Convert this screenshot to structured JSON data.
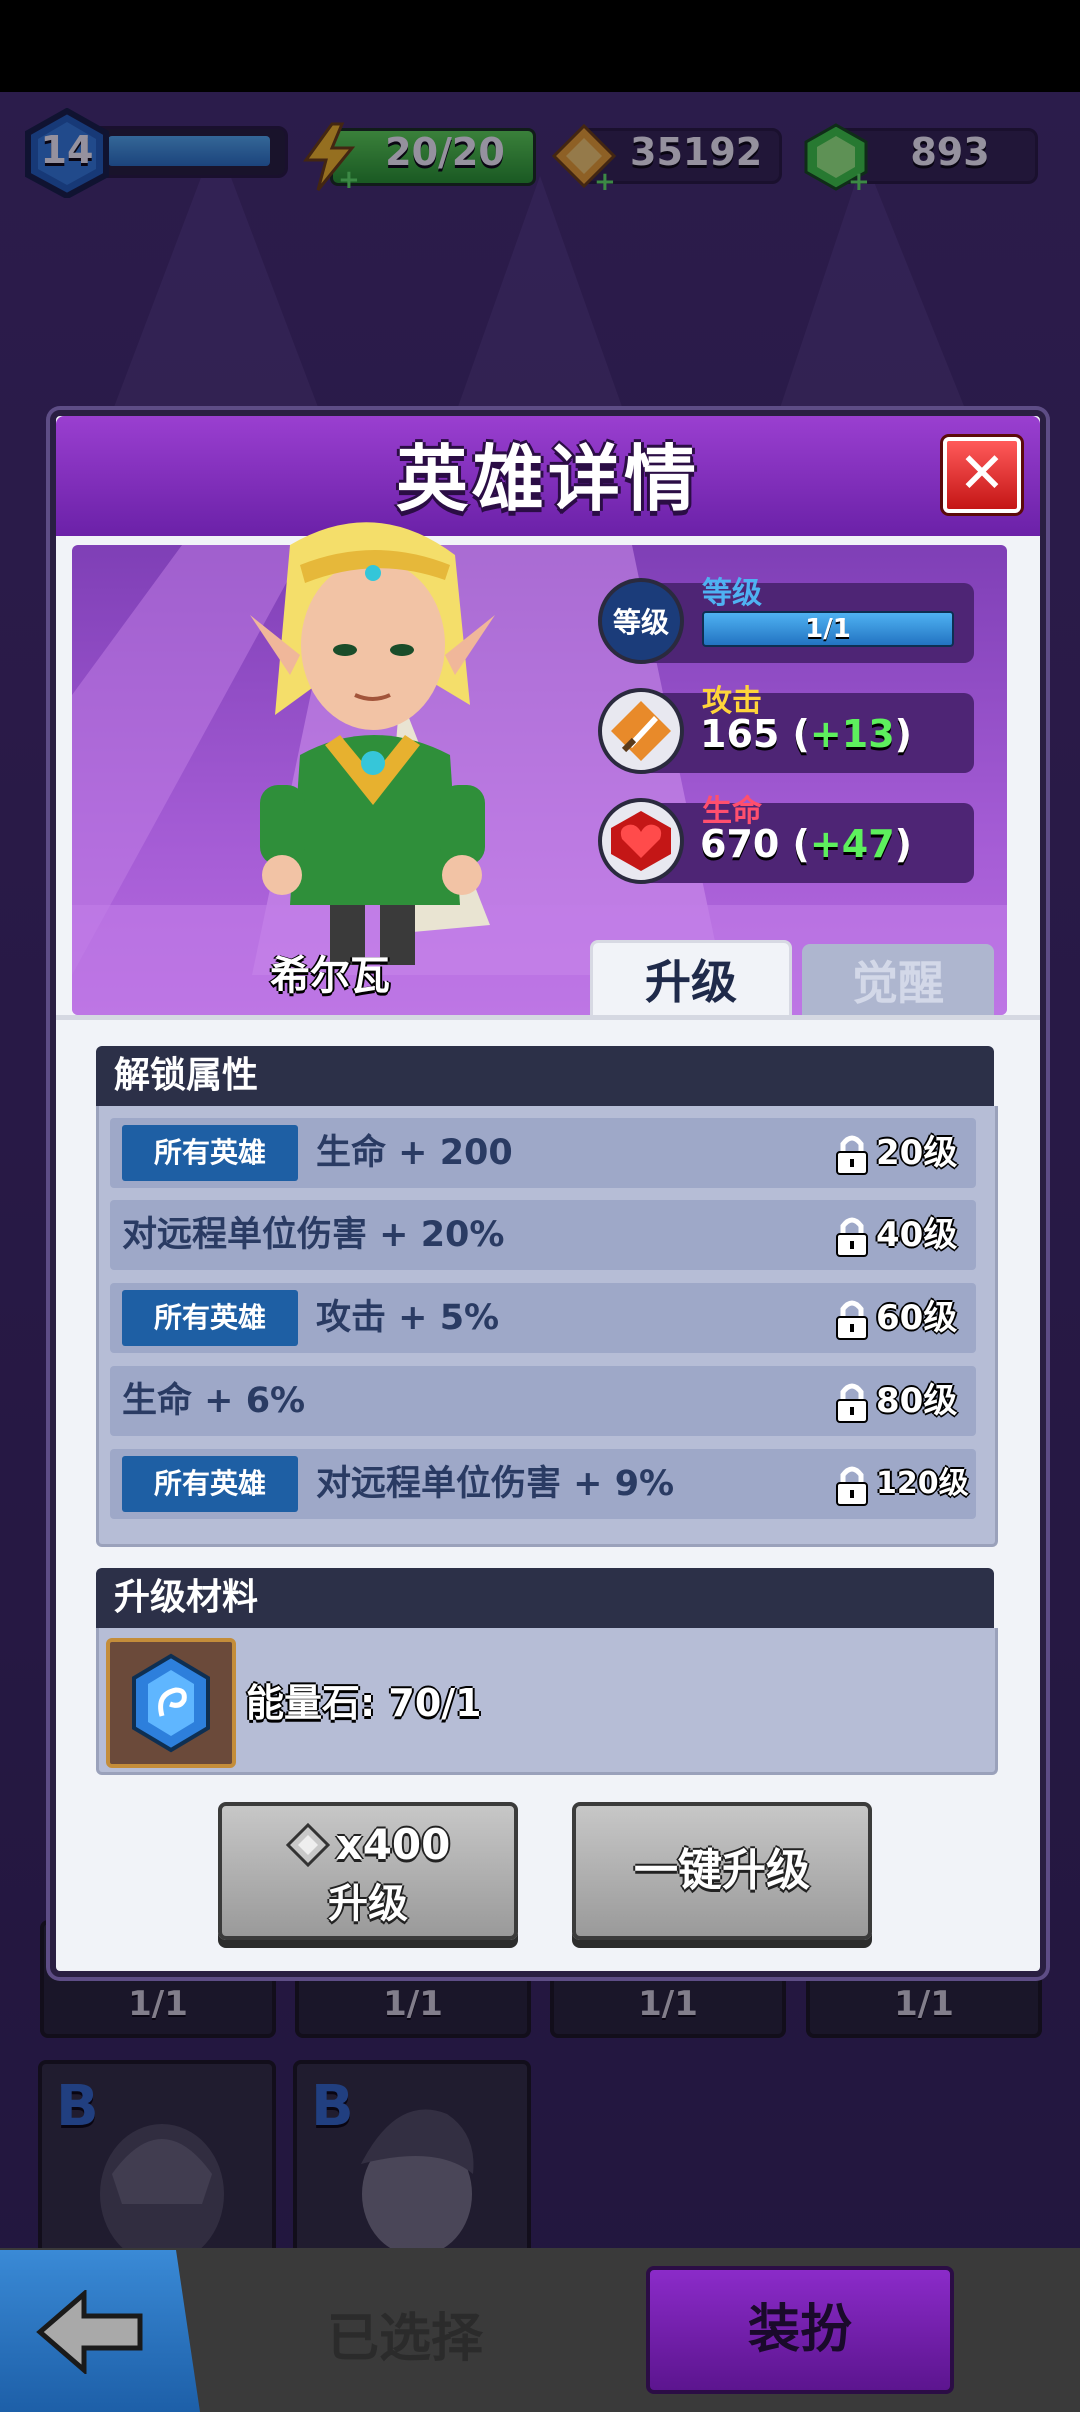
{
  "top_bar": {
    "player_level": "14",
    "energy": "20/20",
    "gold": "35192",
    "gems": "893"
  },
  "modal": {
    "title": "英雄详情",
    "close_label": "✕",
    "hero": {
      "name": "希尔瓦",
      "level_badge": "等级",
      "level_label": "等级",
      "level_value": "1/1",
      "attack_label": "攻击",
      "attack_value": "165 (",
      "attack_bonus": "+13",
      "attack_close": ")",
      "hp_label": "生命",
      "hp_value": "670 (",
      "hp_bonus": "+47",
      "hp_close": ")"
    },
    "tabs": [
      {
        "label": "升级",
        "active": true
      },
      {
        "label": "觉醒",
        "active": false
      }
    ],
    "unlock_section": {
      "title": "解锁属性",
      "rows": [
        {
          "badge": "所有英雄",
          "text": "生命 + 200",
          "level": "20级"
        },
        {
          "badge": "",
          "text": "对远程单位伤害 + 20%",
          "level": "40级"
        },
        {
          "badge": "所有英雄",
          "text": "攻击 + 5%",
          "level": "60级"
        },
        {
          "badge": "",
          "text": "生命 + 6%",
          "level": "80级"
        },
        {
          "badge": "所有英雄",
          "text": "对远程单位伤害 + 9%",
          "level": "120级"
        }
      ]
    },
    "materials_section": {
      "title": "升级材料",
      "item_text": "能量石: 70/1"
    },
    "buttons": {
      "upgrade_cost": "x400",
      "upgrade_label": "升级",
      "one_key_label": "一键升级"
    }
  },
  "background": {
    "card_levels": [
      "1/1",
      "1/1",
      "1/1",
      "1/1"
    ],
    "card_grades": [
      "B",
      "B"
    ]
  },
  "bottom": {
    "selected_label": "已选择",
    "equip_label": "装扮"
  },
  "colors": {
    "header_purple": "#7a2bb8",
    "bonus_green": "#5df05d",
    "badge_blue": "#1e5fa4",
    "section_dark": "#2c3048"
  }
}
